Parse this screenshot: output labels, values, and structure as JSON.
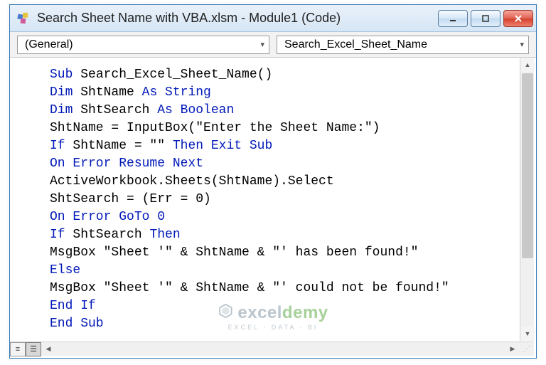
{
  "window": {
    "title": "Search Sheet Name with VBA.xlsm - Module1 (Code)"
  },
  "dropdowns": {
    "object": "(General)",
    "procedure": "Search_Excel_Sheet_Name"
  },
  "code": {
    "tokens": [
      [
        {
          "t": "Sub ",
          "kw": true
        },
        {
          "t": "Search_Excel_Sheet_Name()",
          "kw": false
        }
      ],
      [
        {
          "t": "Dim ",
          "kw": true
        },
        {
          "t": "ShtName ",
          "kw": false
        },
        {
          "t": "As String",
          "kw": true
        }
      ],
      [
        {
          "t": "Dim ",
          "kw": true
        },
        {
          "t": "ShtSearch ",
          "kw": false
        },
        {
          "t": "As Boolean",
          "kw": true
        }
      ],
      [
        {
          "t": "ShtName = InputBox(\"Enter the Sheet Name:\")",
          "kw": false
        }
      ],
      [
        {
          "t": "If ",
          "kw": true
        },
        {
          "t": "ShtName = \"\" ",
          "kw": false
        },
        {
          "t": "Then Exit Sub",
          "kw": true
        }
      ],
      [
        {
          "t": "On Error Resume Next",
          "kw": true
        }
      ],
      [
        {
          "t": "ActiveWorkbook.Sheets(ShtName).Select",
          "kw": false
        }
      ],
      [
        {
          "t": "ShtSearch = (Err = 0)",
          "kw": false
        }
      ],
      [
        {
          "t": "On Error GoTo 0",
          "kw": true
        }
      ],
      [
        {
          "t": "If ",
          "kw": true
        },
        {
          "t": "ShtSearch ",
          "kw": false
        },
        {
          "t": "Then",
          "kw": true
        }
      ],
      [
        {
          "t": "MsgBox \"Sheet '\" & ShtName & \"' has been found!\"",
          "kw": false
        }
      ],
      [
        {
          "t": "Else",
          "kw": true
        }
      ],
      [
        {
          "t": "MsgBox \"Sheet '\" & ShtName & \"' could not be found!\"",
          "kw": false
        }
      ],
      [
        {
          "t": "End If",
          "kw": true
        }
      ],
      [
        {
          "t": "End Sub",
          "kw": true
        }
      ]
    ]
  },
  "watermark": {
    "brand_prefix": "excel",
    "brand_suffix": "demy",
    "tagline": "EXCEL · DATA · BI"
  }
}
